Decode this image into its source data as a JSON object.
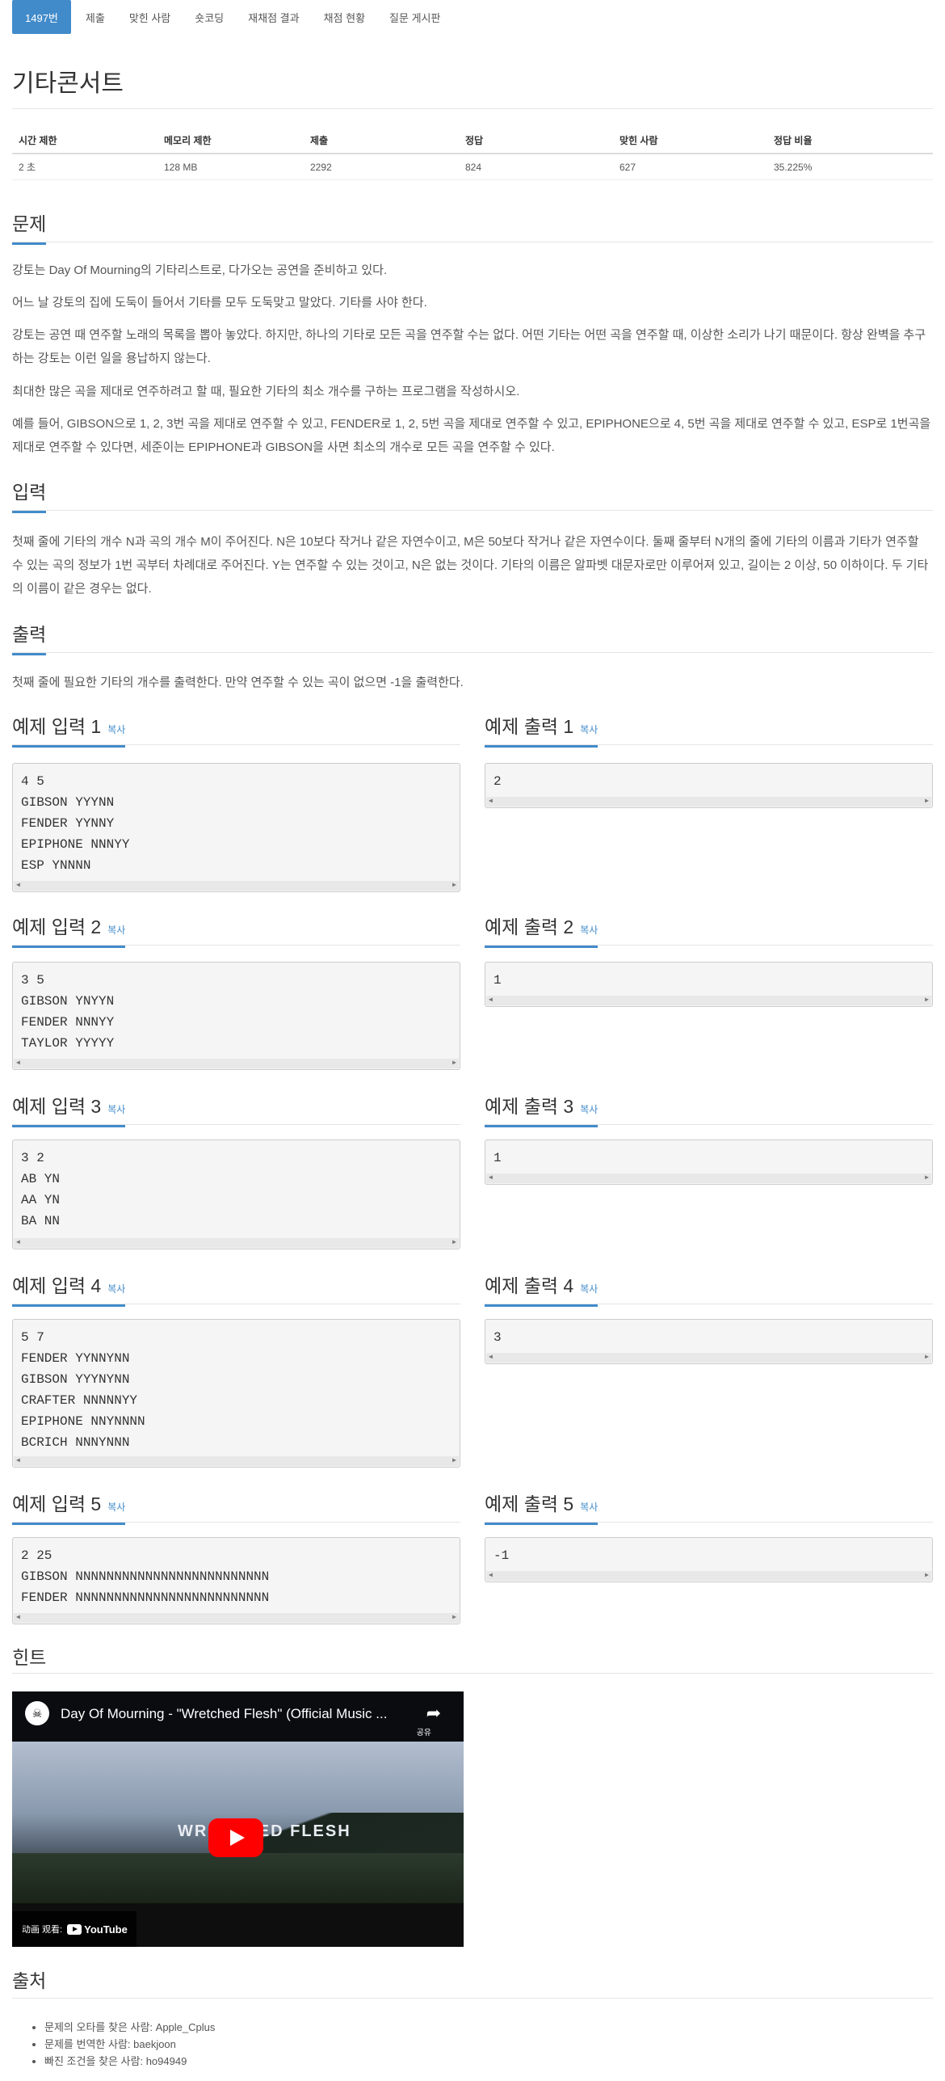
{
  "tabs": [
    "1497번",
    "제출",
    "맞힌 사람",
    "숏코딩",
    "재채점 결과",
    "채점 현황",
    "질문 게시판"
  ],
  "title": "기타콘서트",
  "info": {
    "headers": [
      "시간 제한",
      "메모리 제한",
      "제출",
      "정답",
      "맞힌 사람",
      "정답 비율"
    ],
    "values": [
      "2 초",
      "128 MB",
      "2292",
      "824",
      "627",
      "35.225%"
    ]
  },
  "sections": {
    "problem": "문제",
    "input": "입력",
    "output": "출력",
    "hint": "힌트",
    "source": "출처"
  },
  "problem_paragraphs": [
    "강토는 Day Of Mourning의 기타리스트로, 다가오는 공연을 준비하고 있다.",
    "어느 날 강토의 집에 도둑이 들어서 기타를 모두 도둑맞고 말았다. 기타를 사야 한다.",
    "강토는 공연 때 연주할 노래의 목록을 뽑아 놓았다. 하지만, 하나의 기타로 모든 곡을 연주할 수는 없다. 어떤 기타는 어떤 곡을 연주할 때, 이상한 소리가 나기 때문이다. 항상 완벽을 추구하는 강토는 이런 일을 용납하지 않는다.",
    "최대한 많은 곡을 제대로 연주하려고 할 때, 필요한 기타의 최소 개수를 구하는 프로그램을 작성하시오.",
    "예를 들어, GIBSON으로 1, 2, 3번 곡을 제대로 연주할 수 있고, FENDER로 1, 2, 5번 곡을 제대로 연주할 수 있고, EPIPHONE으로 4, 5번 곡을 제대로 연주할 수 있고, ESP로 1번곡을 제대로 연주할 수 있다면, 세준이는 EPIPHONE과 GIBSON을 사면 최소의 개수로 모든 곡을 연주할 수 있다."
  ],
  "input_text": "첫째 줄에 기타의 개수 N과 곡의 개수 M이 주어진다. N은 10보다 작거나 같은 자연수이고, M은 50보다 작거나 같은 자연수이다. 둘째 줄부터 N개의 줄에 기타의 이름과 기타가 연주할 수 있는 곡의 정보가 1번 곡부터 차례대로 주어진다. Y는 연주할 수 있는 것이고, N은 없는 것이다. 기타의 이름은 알파벳 대문자로만 이루어져 있고, 길이는 2 이상, 50 이하이다. 두 기타의 이름이 같은 경우는 없다.",
  "output_text": "첫째 줄에 필요한 기타의 개수를 출력한다. 만약 연주할 수 있는 곡이 없으면 -1을 출력한다.",
  "copy_label": "복사",
  "samples": [
    {
      "in_title": "예제 입력 1",
      "out_title": "예제 출력 1",
      "input": "4 5\nGIBSON YYYNN\nFENDER YYNNY\nEPIPHONE NNNYY\nESP YNNNN",
      "output": "2"
    },
    {
      "in_title": "예제 입력 2",
      "out_title": "예제 출력 2",
      "input": "3 5\nGIBSON YNYYN\nFENDER NNNYY\nTAYLOR YYYYY",
      "output": "1"
    },
    {
      "in_title": "예제 입력 3",
      "out_title": "예제 출력 3",
      "input": "3 2\nAB YN\nAA YN\nBA NN",
      "output": "1"
    },
    {
      "in_title": "예제 입력 4",
      "out_title": "예제 출력 4",
      "input": "5 7\nFENDER YYNNYNN\nGIBSON YYYNYNN\nCRAFTER NNNNNYY\nEPIPHONE NNYNNNN\nBCRICH NNNYNNN",
      "output": "3"
    },
    {
      "in_title": "예제 입력 5",
      "out_title": "예제 출력 5",
      "input": "2 25\nGIBSON NNNNNNNNNNNNNNNNNNNNNNNNN\nFENDER NNNNNNNNNNNNNNNNNNNNNNNNN",
      "output": "-1"
    }
  ],
  "video": {
    "title": "Day Of Mourning - \"Wretched Flesh\" (Official Music ...",
    "overlay_text": "WRETCHED FLESH",
    "watch_label": "动画 观看:",
    "youtube_label": "YouTube",
    "share_label": "공유"
  },
  "sources": [
    "문제의 오타를 찾은 사람: Apple_Cplus",
    "문제를 번역한 사람: baekjoon",
    "빠진 조건을 찾은 사람: ho94949"
  ]
}
